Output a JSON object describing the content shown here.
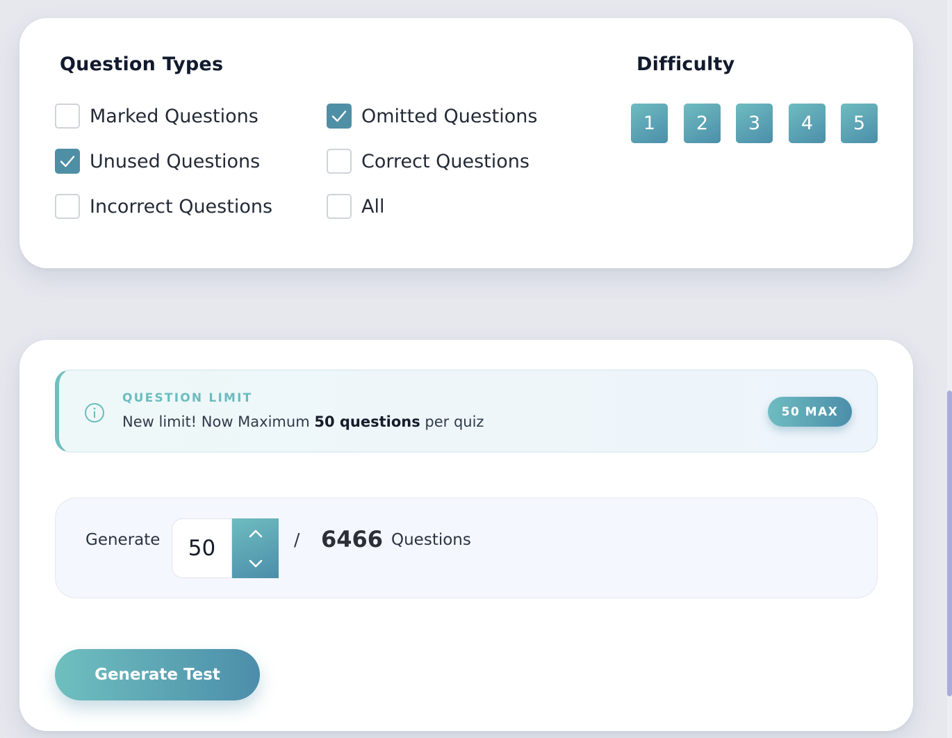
{
  "filters": {
    "question_types_heading": "Question Types",
    "difficulty_heading": "Difficulty",
    "options": [
      {
        "label": "Marked Questions",
        "checked": false
      },
      {
        "label": "Omitted Questions",
        "checked": true
      },
      {
        "label": "Unused Questions",
        "checked": true
      },
      {
        "label": "Correct Questions",
        "checked": false
      },
      {
        "label": "Incorrect Questions",
        "checked": false
      },
      {
        "label": "All",
        "checked": false
      }
    ],
    "difficulty_levels": [
      "1",
      "2",
      "3",
      "4",
      "5"
    ]
  },
  "notice": {
    "icon": "info-icon",
    "title": "QUESTION LIMIT",
    "text_prefix": "New limit! Now Maximum ",
    "text_bold": "50 questions",
    "text_suffix": " per quiz",
    "badge": "50 MAX"
  },
  "generator": {
    "label": "Generate",
    "quantity": "50",
    "separator": "/",
    "total": "6466",
    "unit_label": "Questions",
    "button_label": "Generate Test"
  },
  "colors": {
    "accent_start": "#6ebcc0",
    "accent_end": "#4c8eaa",
    "checkbox_checked": "#4f8fa6"
  }
}
